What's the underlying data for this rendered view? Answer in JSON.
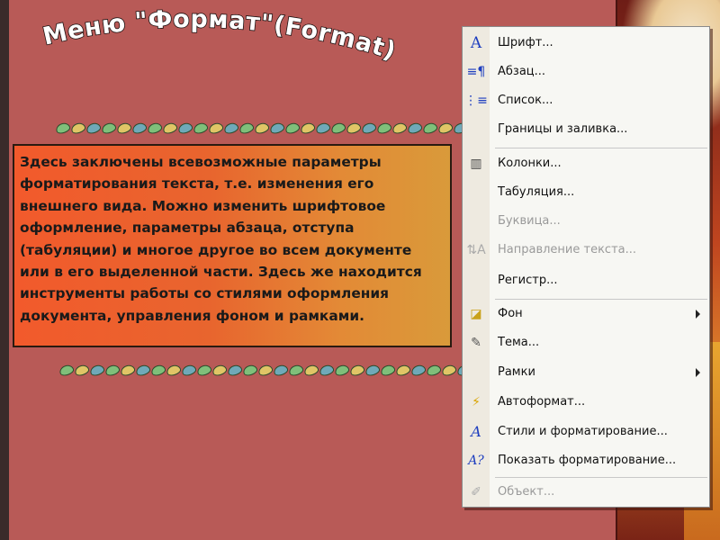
{
  "title": "Меню \"Формат\"(Format)",
  "description": "Здесь заключены всевозможные параметры форматирования текста, т.е. изменения его внешнего вида. Можно изменить шрифтовое оформление, параметры абзаца, отступа (табуляции) и многое другое во всем документе или в его выделенной части. Здесь же находится инструменты работы со стилями оформления документа, управления фоном и рамками.",
  "menu": {
    "items": [
      {
        "label": "Шрифт...",
        "icon": "A",
        "enabled": true
      },
      {
        "label": "Абзац...",
        "icon": "≡¶",
        "enabled": true
      },
      {
        "label": "Список...",
        "icon": "⋮≡",
        "enabled": true
      },
      {
        "label": "Границы и заливка...",
        "icon": "",
        "enabled": true
      },
      {
        "label": "Колонки...",
        "icon": "▥",
        "enabled": true
      },
      {
        "label": "Табуляция...",
        "icon": "",
        "enabled": true
      },
      {
        "label": "Буквица...",
        "icon": "",
        "enabled": false
      },
      {
        "label": "Направление текста...",
        "icon": "⇅A",
        "enabled": false
      },
      {
        "label": "Регистр...",
        "icon": "",
        "enabled": true
      },
      {
        "label": "Фон",
        "icon": "◪",
        "enabled": true,
        "submenu": true
      },
      {
        "label": "Тема...",
        "icon": "✎",
        "enabled": true
      },
      {
        "label": "Рамки",
        "icon": "",
        "enabled": true,
        "submenu": true
      },
      {
        "label": "Автоформат...",
        "icon": "⚡",
        "enabled": true
      },
      {
        "label": "Стили и форматирование...",
        "icon": "A",
        "enabled": true
      },
      {
        "label": "Показать форматирование...",
        "icon": "A?",
        "enabled": true
      },
      {
        "label": "Объект...",
        "icon": "✐",
        "enabled": false
      }
    ]
  }
}
